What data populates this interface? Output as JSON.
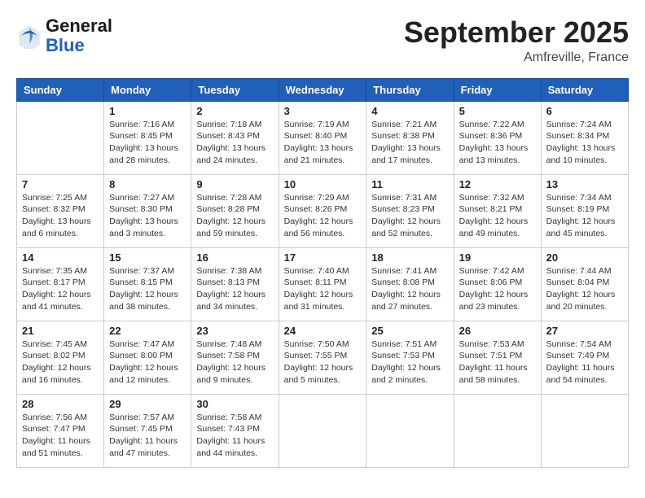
{
  "logo": {
    "general": "General",
    "blue": "Blue"
  },
  "header": {
    "month": "September 2025",
    "location": "Amfreville, France"
  },
  "days_of_week": [
    "Sunday",
    "Monday",
    "Tuesday",
    "Wednesday",
    "Thursday",
    "Friday",
    "Saturday"
  ],
  "weeks": [
    [
      {
        "day": "",
        "info": ""
      },
      {
        "day": "1",
        "info": "Sunrise: 7:16 AM\nSunset: 8:45 PM\nDaylight: 13 hours\nand 28 minutes."
      },
      {
        "day": "2",
        "info": "Sunrise: 7:18 AM\nSunset: 8:43 PM\nDaylight: 13 hours\nand 24 minutes."
      },
      {
        "day": "3",
        "info": "Sunrise: 7:19 AM\nSunset: 8:40 PM\nDaylight: 13 hours\nand 21 minutes."
      },
      {
        "day": "4",
        "info": "Sunrise: 7:21 AM\nSunset: 8:38 PM\nDaylight: 13 hours\nand 17 minutes."
      },
      {
        "day": "5",
        "info": "Sunrise: 7:22 AM\nSunset: 8:36 PM\nDaylight: 13 hours\nand 13 minutes."
      },
      {
        "day": "6",
        "info": "Sunrise: 7:24 AM\nSunset: 8:34 PM\nDaylight: 13 hours\nand 10 minutes."
      }
    ],
    [
      {
        "day": "7",
        "info": "Sunrise: 7:25 AM\nSunset: 8:32 PM\nDaylight: 13 hours\nand 6 minutes."
      },
      {
        "day": "8",
        "info": "Sunrise: 7:27 AM\nSunset: 8:30 PM\nDaylight: 13 hours\nand 3 minutes."
      },
      {
        "day": "9",
        "info": "Sunrise: 7:28 AM\nSunset: 8:28 PM\nDaylight: 12 hours\nand 59 minutes."
      },
      {
        "day": "10",
        "info": "Sunrise: 7:29 AM\nSunset: 8:26 PM\nDaylight: 12 hours\nand 56 minutes."
      },
      {
        "day": "11",
        "info": "Sunrise: 7:31 AM\nSunset: 8:23 PM\nDaylight: 12 hours\nand 52 minutes."
      },
      {
        "day": "12",
        "info": "Sunrise: 7:32 AM\nSunset: 8:21 PM\nDaylight: 12 hours\nand 49 minutes."
      },
      {
        "day": "13",
        "info": "Sunrise: 7:34 AM\nSunset: 8:19 PM\nDaylight: 12 hours\nand 45 minutes."
      }
    ],
    [
      {
        "day": "14",
        "info": "Sunrise: 7:35 AM\nSunset: 8:17 PM\nDaylight: 12 hours\nand 41 minutes."
      },
      {
        "day": "15",
        "info": "Sunrise: 7:37 AM\nSunset: 8:15 PM\nDaylight: 12 hours\nand 38 minutes."
      },
      {
        "day": "16",
        "info": "Sunrise: 7:38 AM\nSunset: 8:13 PM\nDaylight: 12 hours\nand 34 minutes."
      },
      {
        "day": "17",
        "info": "Sunrise: 7:40 AM\nSunset: 8:11 PM\nDaylight: 12 hours\nand 31 minutes."
      },
      {
        "day": "18",
        "info": "Sunrise: 7:41 AM\nSunset: 8:08 PM\nDaylight: 12 hours\nand 27 minutes."
      },
      {
        "day": "19",
        "info": "Sunrise: 7:42 AM\nSunset: 8:06 PM\nDaylight: 12 hours\nand 23 minutes."
      },
      {
        "day": "20",
        "info": "Sunrise: 7:44 AM\nSunset: 8:04 PM\nDaylight: 12 hours\nand 20 minutes."
      }
    ],
    [
      {
        "day": "21",
        "info": "Sunrise: 7:45 AM\nSunset: 8:02 PM\nDaylight: 12 hours\nand 16 minutes."
      },
      {
        "day": "22",
        "info": "Sunrise: 7:47 AM\nSunset: 8:00 PM\nDaylight: 12 hours\nand 12 minutes."
      },
      {
        "day": "23",
        "info": "Sunrise: 7:48 AM\nSunset: 7:58 PM\nDaylight: 12 hours\nand 9 minutes."
      },
      {
        "day": "24",
        "info": "Sunrise: 7:50 AM\nSunset: 7:55 PM\nDaylight: 12 hours\nand 5 minutes."
      },
      {
        "day": "25",
        "info": "Sunrise: 7:51 AM\nSunset: 7:53 PM\nDaylight: 12 hours\nand 2 minutes."
      },
      {
        "day": "26",
        "info": "Sunrise: 7:53 AM\nSunset: 7:51 PM\nDaylight: 11 hours\nand 58 minutes."
      },
      {
        "day": "27",
        "info": "Sunrise: 7:54 AM\nSunset: 7:49 PM\nDaylight: 11 hours\nand 54 minutes."
      }
    ],
    [
      {
        "day": "28",
        "info": "Sunrise: 7:56 AM\nSunset: 7:47 PM\nDaylight: 11 hours\nand 51 minutes."
      },
      {
        "day": "29",
        "info": "Sunrise: 7:57 AM\nSunset: 7:45 PM\nDaylight: 11 hours\nand 47 minutes."
      },
      {
        "day": "30",
        "info": "Sunrise: 7:58 AM\nSunset: 7:43 PM\nDaylight: 11 hours\nand 44 minutes."
      },
      {
        "day": "",
        "info": ""
      },
      {
        "day": "",
        "info": ""
      },
      {
        "day": "",
        "info": ""
      },
      {
        "day": "",
        "info": ""
      }
    ]
  ]
}
